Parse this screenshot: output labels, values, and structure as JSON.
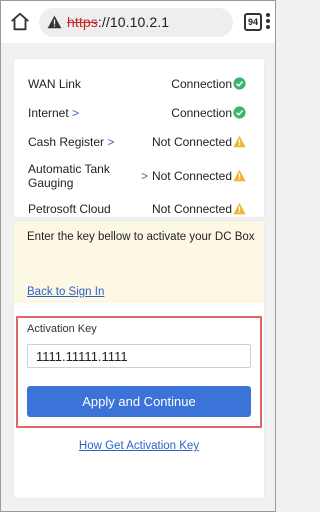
{
  "browser": {
    "url_protocol": "https",
    "url_rest": "://10.10.2.1",
    "tab_count": "94",
    "icons": {
      "home": "home-icon",
      "security": "warning-icon",
      "menu": "more-vert-icon"
    }
  },
  "status": {
    "rows": [
      {
        "label": "WAN Link",
        "has_chevron": false,
        "state": "Connection",
        "icon": "check-circle-icon"
      },
      {
        "label": "Internet",
        "has_chevron": true,
        "chevron": ">",
        "state": "Connection",
        "icon": "check-circle-icon"
      },
      {
        "label": "Cash Register",
        "has_chevron": true,
        "chevron": ">",
        "state": "Not Connected",
        "icon": "warning-icon"
      },
      {
        "label_line1": "Automatic Tank",
        "label_line2": "Gauging",
        "has_chevron": true,
        "chevron": ">",
        "state": "Not Connected",
        "icon": "warning-icon"
      },
      {
        "label": "Petrosoft Cloud",
        "has_chevron": false,
        "state": "Not Connected",
        "icon": "warning-icon"
      }
    ]
  },
  "activation": {
    "instruction": "Enter the key bellow to activate your DC Box",
    "back_link": "Back to Sign In",
    "key_label": "Activation Key",
    "key_value": "1111.11111.1111",
    "apply_button": "Apply and Continue",
    "help_link": "How Get Activation Key"
  },
  "colors": {
    "ok": "#3cb371",
    "warn": "#f0b429",
    "link": "#2d63c8",
    "button": "#3b73d8",
    "banner": "#fdf8e3",
    "highlight": "#e06666"
  }
}
